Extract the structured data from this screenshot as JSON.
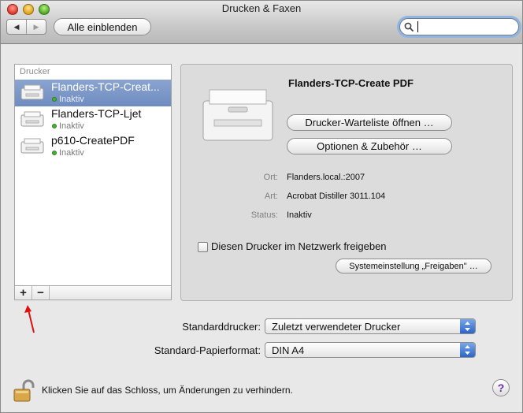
{
  "window": {
    "title": "Drucken & Faxen"
  },
  "toolbar": {
    "back_glyph": "◀",
    "forward_glyph": "▶",
    "show_all_label": "Alle einblenden",
    "search_placeholder": ""
  },
  "sidebar": {
    "header": "Drucker",
    "printers": [
      {
        "name": "Flanders-TCP-Creat...",
        "status": "Inaktiv",
        "selected": true
      },
      {
        "name": "Flanders-TCP-Ljet",
        "status": "Inaktiv",
        "selected": false
      },
      {
        "name": "p610-CreatePDF",
        "status": "Inaktiv",
        "selected": false
      }
    ],
    "add_glyph": "+",
    "remove_glyph": "−"
  },
  "detail": {
    "printer_name": "Flanders-TCP-Create PDF",
    "queue_button": "Drucker-Warteliste öffnen …",
    "options_button": "Optionen & Zubehör …",
    "location_label": "Ort:",
    "location_value": "Flanders.local.:2007",
    "kind_label": "Art:",
    "kind_value": "Acrobat Distiller 3011.104",
    "status_label": "Status:",
    "status_value": "Inaktiv",
    "share_checkbox_label": "Diesen Drucker im Netzwerk freigeben",
    "share_checked": false,
    "sharing_prefs_button": "Systemeinstellung „Freigaben\" …"
  },
  "defaults": {
    "default_printer_label": "Standarddrucker:",
    "default_printer_value": "Zuletzt verwendeter Drucker",
    "paper_size_label": "Standard-Papierformat:",
    "paper_size_value": "DIN A4"
  },
  "footer": {
    "lock_text": "Klicken Sie auf das Schloss, um Änderungen zu verhindern.",
    "help_glyph": "?"
  },
  "colors": {
    "selection": "#7a95c8",
    "status_active": "#46b035",
    "annotation_arrow": "#e01010",
    "focus_ring": "#8fb5e5"
  }
}
